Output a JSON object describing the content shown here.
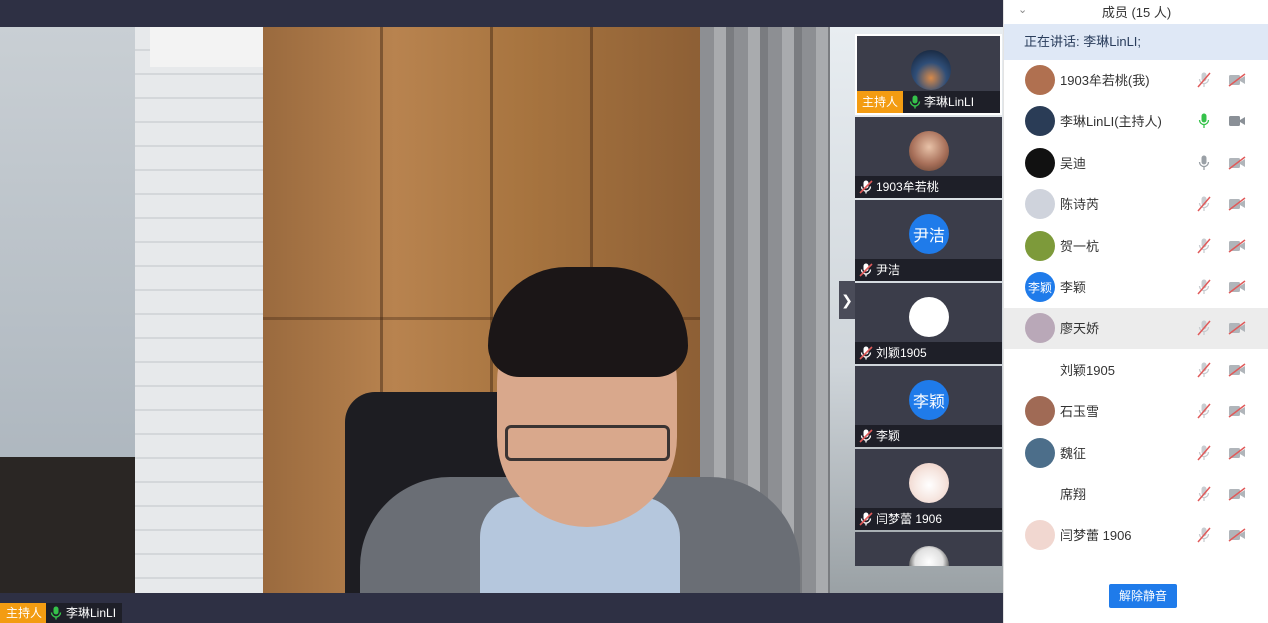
{
  "main": {
    "host_badge": "主持人",
    "host_name": "李琳LinLI"
  },
  "thumbs": [
    {
      "host_tag": "主持人",
      "name": "李琳LinLI",
      "mic": "on",
      "avatar_text": "",
      "avatar_color": "#1b2a3e",
      "active": true
    },
    {
      "name": "1903牟若桃",
      "mic": "muted",
      "avatar_text": "",
      "avatar_color": "#c48a6a"
    },
    {
      "name": "尹洁",
      "mic": "muted",
      "avatar_text": "尹洁",
      "avatar_color": "#1f7bea"
    },
    {
      "name": "刘颖1905",
      "mic": "muted",
      "avatar_text": "",
      "avatar_color": "#ffffff"
    },
    {
      "name": "李颖",
      "mic": "muted",
      "avatar_text": "李颖",
      "avatar_color": "#1f7bea"
    },
    {
      "name": "闫梦蕾 1906",
      "mic": "muted",
      "avatar_text": "",
      "avatar_color": "#f3d9d3"
    },
    {
      "name": "",
      "mic": "",
      "avatar_text": "",
      "avatar_color": "#e8e8e8"
    }
  ],
  "panel": {
    "title": "成员 (15 人)",
    "speaking": "正在讲话: 李琳LinLI;",
    "unmute_label": "解除静音",
    "members": [
      {
        "name": "1903牟若桃(我)",
        "avatar_text": "",
        "avatar_color": "#b07050",
        "mic": "muted",
        "cam": "off"
      },
      {
        "name": "李琳LinLI(主持人)",
        "avatar_text": "",
        "avatar_color": "#2a3c56",
        "mic": "on",
        "cam": "on"
      },
      {
        "name": "吴迪",
        "avatar_text": "",
        "avatar_color": "#111111",
        "mic": "idle",
        "cam": "off"
      },
      {
        "name": "陈诗芮",
        "avatar_text": "",
        "avatar_color": "#cfd3dc",
        "mic": "muted",
        "cam": "off"
      },
      {
        "name": "贺一杭",
        "avatar_text": "",
        "avatar_color": "#7d9a3a",
        "mic": "muted",
        "cam": "off"
      },
      {
        "name": "李颖",
        "avatar_text": "李颖",
        "avatar_color": "#1f7bea",
        "mic": "muted",
        "cam": "off"
      },
      {
        "name": "廖天娇",
        "avatar_text": "",
        "avatar_color": "#b9a8b8",
        "mic": "muted",
        "cam": "off"
      },
      {
        "name": "刘颖1905",
        "avatar_text": "",
        "avatar_color": "#ffffff",
        "mic": "muted",
        "cam": "off"
      },
      {
        "name": "石玉雪",
        "avatar_text": "",
        "avatar_color": "#a06a55",
        "mic": "muted",
        "cam": "off"
      },
      {
        "name": "魏征",
        "avatar_text": "",
        "avatar_color": "#4c6e8a",
        "mic": "muted",
        "cam": "off"
      },
      {
        "name": "席翔",
        "avatar_text": "",
        "avatar_color": "#ffffff",
        "mic": "muted",
        "cam": "off"
      },
      {
        "name": "闫梦蕾 1906",
        "avatar_text": "",
        "avatar_color": "#f1d7d0",
        "mic": "muted",
        "cam": "off"
      }
    ]
  },
  "colors": {
    "accent": "#1f7bea",
    "host_badge": "#f39c12",
    "mic_on": "#35c24a",
    "muted": "#e05a5a"
  }
}
